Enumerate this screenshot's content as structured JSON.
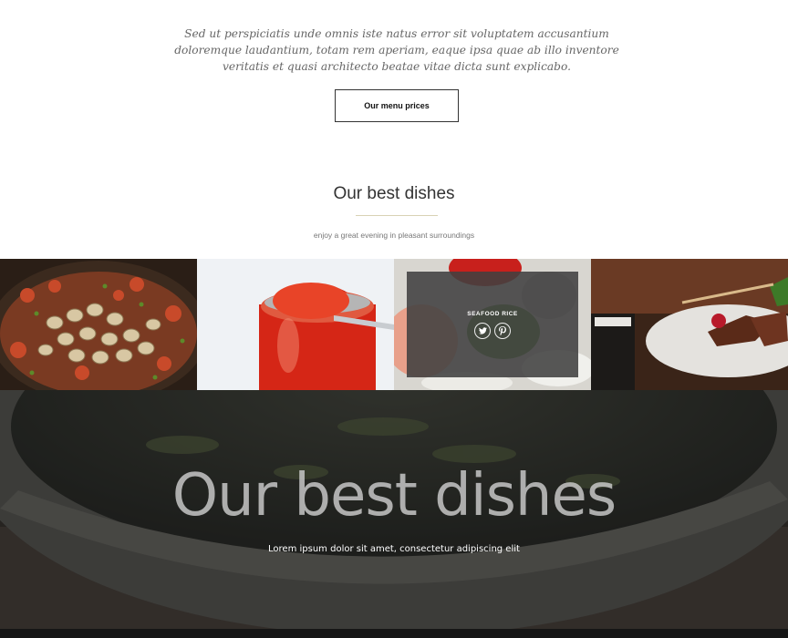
{
  "intro": {
    "text": "Sed ut perspiciatis unde omnis iste natus error sit voluptatem accusantium doloremque laudantium, totam rem aperiam, eaque ipsa quae ab illo inventore veritatis et quasi architecto beatae vitae dicta sunt explicabo.",
    "button_label": "Our menu prices"
  },
  "dishes_section": {
    "title": "Our best dishes",
    "subtitle": "enjoy a great evening in pleasant surroundings"
  },
  "gallery": {
    "hover_tile": {
      "title": "SEAFOOD RICE",
      "social_icons": [
        "twitter-icon",
        "pinterest-icon"
      ]
    }
  },
  "hero": {
    "title": "Our best dishes",
    "subtitle": "Lorem ipsum dolor sit amet, consectetur adipiscing elit"
  }
}
